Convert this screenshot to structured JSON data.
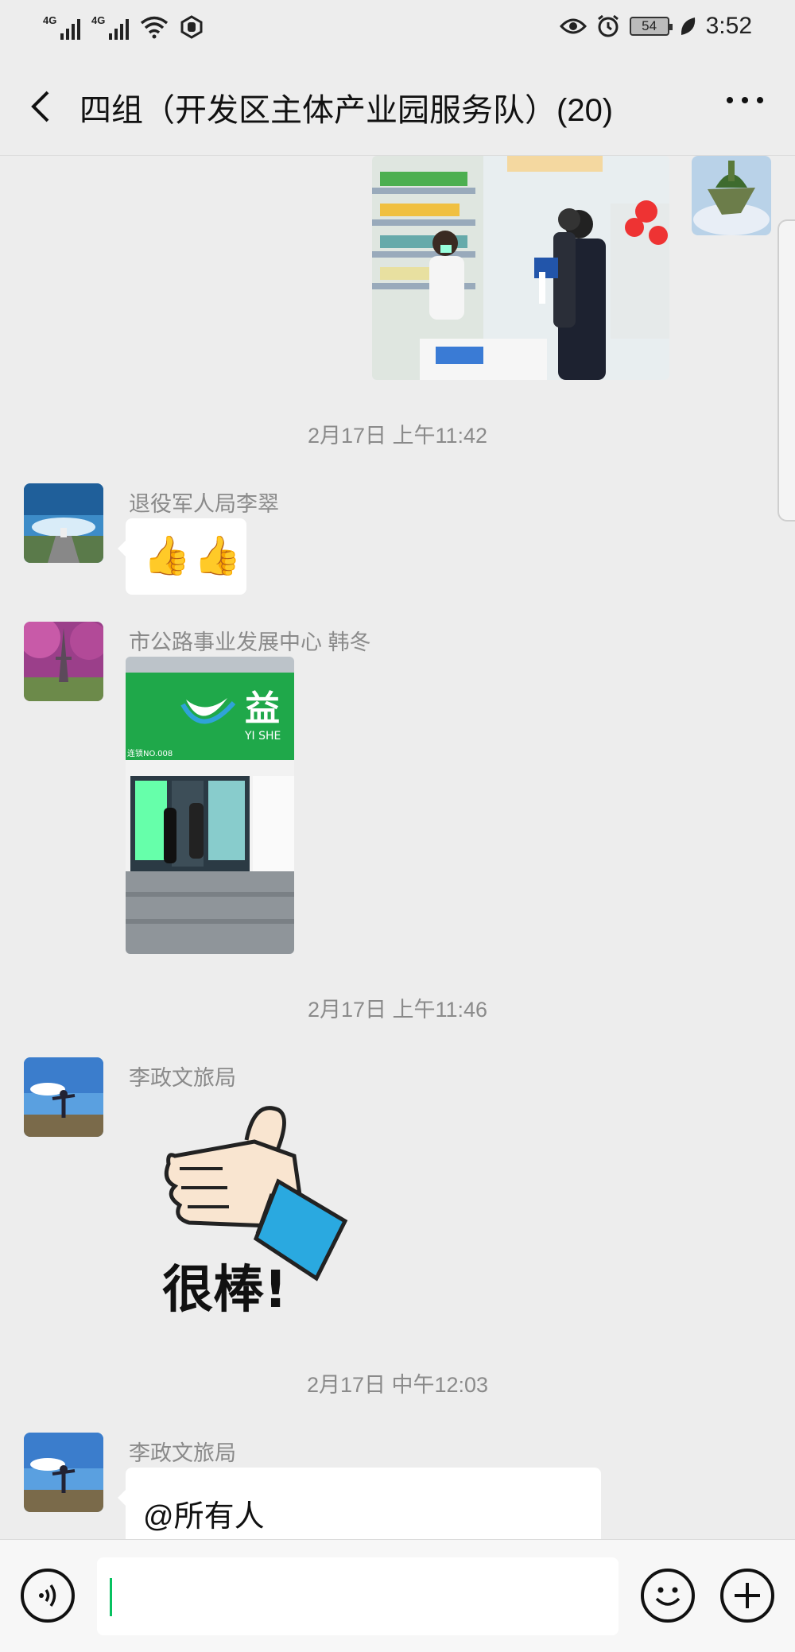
{
  "status_bar": {
    "signal1": "4G",
    "signal2": "4G",
    "battery": "54",
    "time": "3:52"
  },
  "header": {
    "title": "四组（开发区主体产业园服务队）(20)"
  },
  "messages": {
    "ts1": "2月17日 上午11:42",
    "m1_sender": "退役军人局李翠",
    "m1_emoji": "👍👍",
    "m2_sender": "市公路事业发展中心  韩冬",
    "m2_sign": "益",
    "m2_sign_en": "YI SHE",
    "m2_sign_small": "连锁NO.008",
    "ts2": "2月17日 上午11:46",
    "m3_sender": "李政文旅局",
    "m3_sticker_text": "很棒!",
    "ts3": "2月17日 中午12:03",
    "m4_sender": "李政文旅局",
    "m4_text": "@所有人"
  },
  "colors": {
    "background": "#ededed",
    "bubble": "#ffffff",
    "caret": "#07c160",
    "sticker_cuff": "#2aa9e0",
    "sticker_exclaim": "#e02020"
  },
  "icons": [
    "signal-icon",
    "wifi-icon",
    "eye-icon",
    "alarm-icon",
    "battery-icon",
    "leaf-icon",
    "back-icon",
    "more-icon",
    "voice-icon",
    "emoji-icon",
    "plus-icon"
  ]
}
